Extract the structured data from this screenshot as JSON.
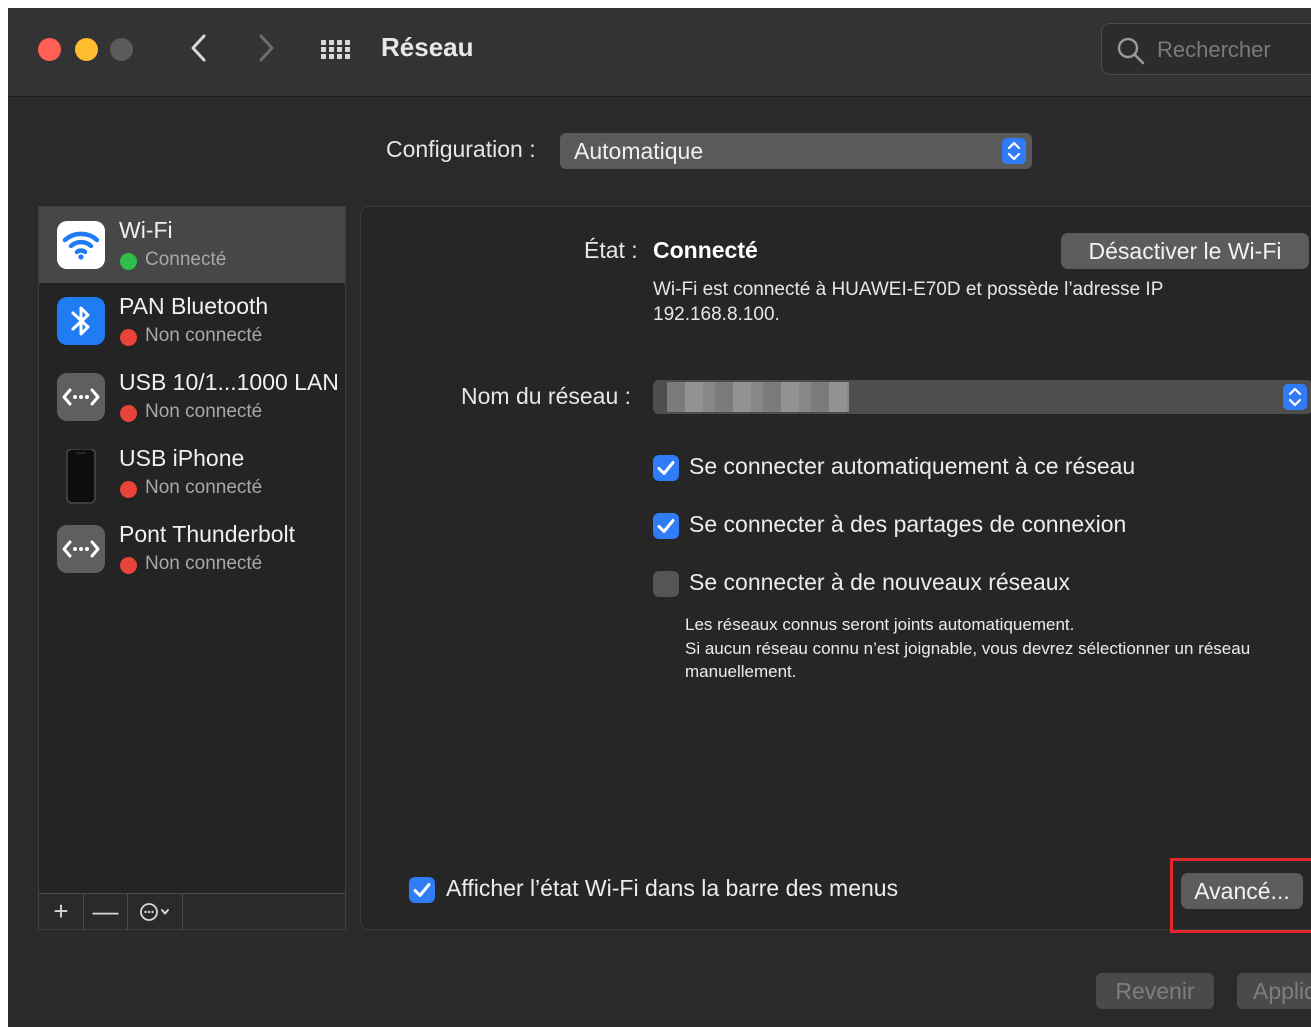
{
  "window": {
    "title": "Réseau",
    "search_placeholder": "Rechercher"
  },
  "config": {
    "label": "Configuration :",
    "value": "Automatique"
  },
  "services": [
    {
      "name": "Wi-Fi",
      "status": "Connecté",
      "status_color": "#2fbf4a",
      "icon": "wifi-icon",
      "selected": true
    },
    {
      "name": "PAN Bluetooth",
      "status": "Non connecté",
      "status_color": "#e8433b",
      "icon": "bluetooth-icon"
    },
    {
      "name": "USB 10/1...1000 LAN",
      "status": "Non connecté",
      "status_color": "#e8433b",
      "icon": "ethernet-icon"
    },
    {
      "name": "USB iPhone",
      "status": "Non connecté",
      "status_color": "#e8433b",
      "icon": "iphone-icon"
    },
    {
      "name": "Pont Thunderbolt",
      "status": "Non connecté",
      "status_color": "#e8433b",
      "icon": "thunderbolt-bridge-icon"
    }
  ],
  "sidebar_toolbar": {
    "add": "+",
    "remove": "—"
  },
  "detail": {
    "state_label": "État :",
    "state_value": "Connecté",
    "disable_button": "Désactiver le Wi-Fi",
    "state_description": "Wi-Fi est connecté à HUAWEI-E70D et possède l’adresse IP 192.168.8.100.",
    "network_name_label": "Nom du réseau :",
    "checkboxes": [
      {
        "label": "Se connecter automatiquement à ce réseau",
        "checked": true
      },
      {
        "label": "Se connecter à des partages de connexion",
        "checked": true
      },
      {
        "label": "Se connecter à de nouveaux réseaux",
        "checked": false
      }
    ],
    "hint_lines": [
      "Les réseaux connus seront joints automatiquement.",
      "Si aucun réseau connu n’est joignable, vous devrez sélectionner un réseau manuellement."
    ],
    "show_status_label": "Afficher l’état Wi-Fi dans la barre des menus",
    "show_status_checked": true,
    "advanced_button": "Avancé..."
  },
  "footer": {
    "revert": "Revenir",
    "apply": "Appliquer"
  },
  "colors": {
    "accent": "#2f7cf6",
    "highlight": "#e0282a"
  }
}
